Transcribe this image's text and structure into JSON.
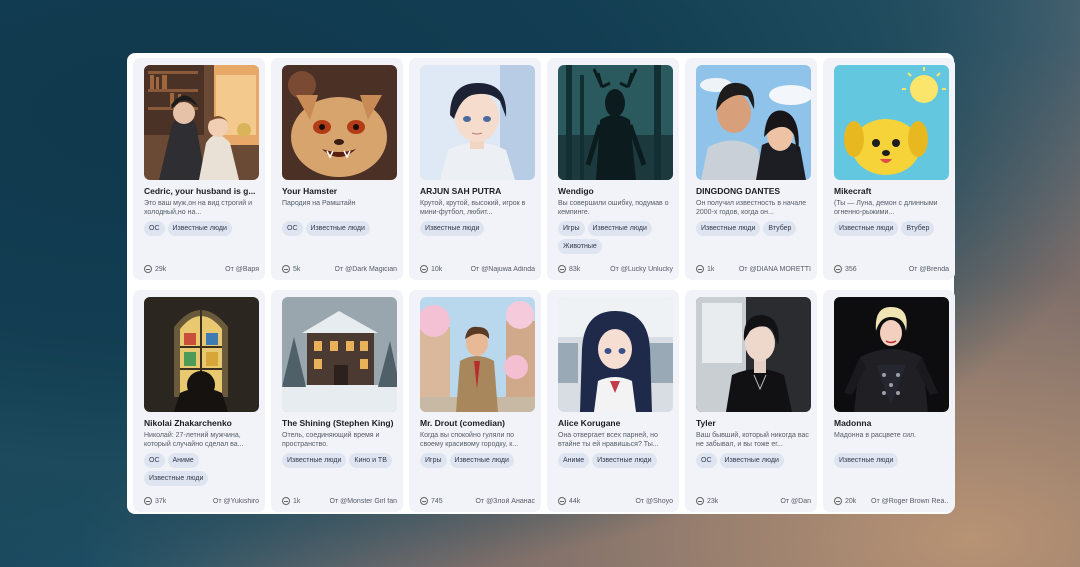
{
  "cards": [
    {
      "title": "Cedric, your husband is g...",
      "desc": "Это ваш муж,он на вид строгий и холодный,но на...",
      "tags": [
        "ОС",
        "Известные люди"
      ],
      "count": "29k",
      "author": "От @Варя",
      "image": "couple-library"
    },
    {
      "title": "Your Hamster",
      "desc": "Пародия на Рамштайн",
      "tags": [
        "ОС",
        "Известные люди"
      ],
      "count": "5k",
      "author": "От @Dark Magician",
      "image": "hamster"
    },
    {
      "title": "ARJUN SAH PUTRA",
      "desc": "Крутой, крутой, высокий, игрок в мини-футбол, любит...",
      "tags": [
        "Известные люди"
      ],
      "count": "10k",
      "author": "От @Najuwa Adinda",
      "image": "anime-boy"
    },
    {
      "title": "Wendigo",
      "desc": "Вы совершили ошибку, подумав о кемпинге.",
      "tags": [
        "Игры",
        "Известные люди",
        "Животные"
      ],
      "count": "83k",
      "author": "От @Lucky Unlucky",
      "image": "wendigo"
    },
    {
      "title": "DINGDONG DANTES",
      "desc": "Он получил известность в начале 2000-х годов, когда он...",
      "tags": [
        "Известные люди",
        "Втубер"
      ],
      "count": "1k",
      "author": "От @DIANA MORETTI",
      "image": "couple-sky"
    },
    {
      "title": "Mikecraft",
      "desc": "(Ты — Луна, демон с длинными огненно-рыжими...",
      "tags": [
        "Известные люди",
        "Втубер"
      ],
      "count": "356",
      "author": "От @Brenda",
      "image": "yellow-dog"
    },
    {
      "title": "Nikolai Zhakarchenko",
      "desc": "Николай: 27-летний мужчина, который случайно сделал ва...",
      "tags": [
        "ОС",
        "Аниме",
        "Известные люди"
      ],
      "count": "37k",
      "author": "От @Yukishiro",
      "image": "church-window"
    },
    {
      "title": "The Shining (Stephen King)",
      "desc": "Отель, соединяющий время и пространство.",
      "tags": [
        "Известные люди",
        "Кино и ТВ"
      ],
      "count": "1k",
      "author": "От @Monster Girl fan",
      "image": "snow-hotel"
    },
    {
      "title": "Mr. Drout (comedian)",
      "desc": "Когда вы спокойно гуляли по своему красивому городку, к...",
      "tags": [
        "Игры",
        "Известные люди"
      ],
      "count": "745",
      "author": "От @Злой Ананас",
      "image": "man-street"
    },
    {
      "title": "Alice Korugane",
      "desc": "Она отвергает всех парней, но втайне ты ей нравишься? Ты...",
      "tags": [
        "Аниме",
        "Известные люди"
      ],
      "count": "44k",
      "author": "От @Shoyo",
      "image": "anime-girl"
    },
    {
      "title": "Tyler",
      "desc": "Ваш бывший, который никогда вас не забывал, и вы тоже ег...",
      "tags": [
        "ОС",
        "Известные люди"
      ],
      "count": "23k",
      "author": "От @Dan",
      "image": "dark-boy"
    },
    {
      "title": "Madonna",
      "desc": "Мадонна в расцвете сил.",
      "tags": [
        "Известные люди"
      ],
      "count": "20k",
      "author": "От @Roger Brown Rea...",
      "image": "madonna"
    }
  ]
}
